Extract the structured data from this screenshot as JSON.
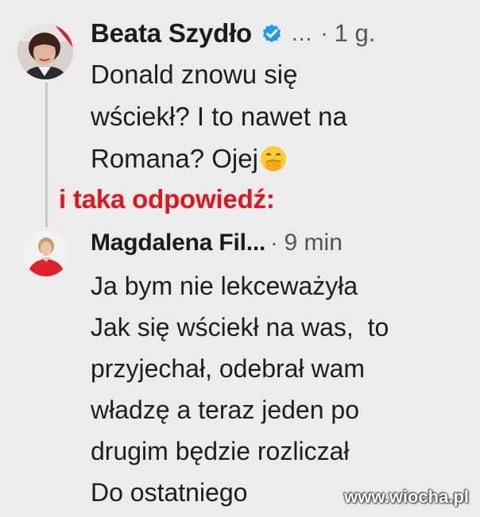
{
  "tweet1": {
    "author": "Beata Szydło",
    "more": "...",
    "dot": "·",
    "time": "1 g.",
    "lines": [
      "Donald znowu się",
      "wściekł? I to nawet na",
      "Romana? Ojej"
    ],
    "emoji": "face-with-hand-over-mouth"
  },
  "caption": "i taka odpowiedź:",
  "tweet2": {
    "author": "Magdalena Fil...",
    "dot": "·",
    "time": "9 min",
    "lines": [
      "Ja bym nie lekceważyła",
      "Jak się wściekł na was,  to",
      "przyjechał, odebrał wam",
      "władzę a teraz jeden po",
      "drugim będzie rozliczał",
      "Do ostatniego"
    ]
  },
  "watermark": "www.wiocha.pl",
  "colors": {
    "background": "#ececec",
    "caption": "#e3151a",
    "verified": "#1d9bf0",
    "text": "#1b1b1b",
    "muted": "#555555"
  },
  "icons": {
    "verified": "verified-badge-icon",
    "emoji": "face-with-hand-over-mouth-icon"
  }
}
